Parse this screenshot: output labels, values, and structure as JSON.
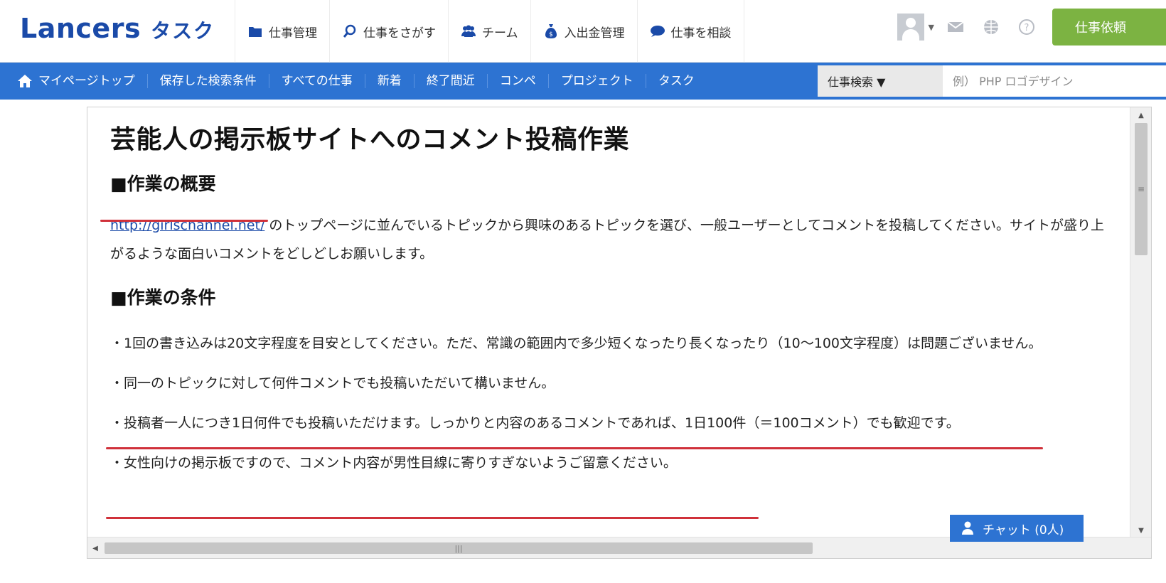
{
  "brand": {
    "logo_main": "Lancers",
    "logo_sub": "タスク",
    "color": "#1a4aa8"
  },
  "header": {
    "nav": [
      {
        "label": "仕事管理",
        "icon": "folder-icon"
      },
      {
        "label": "仕事をさがす",
        "icon": "search-icon"
      },
      {
        "label": "チーム",
        "icon": "team-icon"
      },
      {
        "label": "入出金管理",
        "icon": "money-bag-icon"
      },
      {
        "label": "仕事を相談",
        "icon": "chat-bubble-icon"
      }
    ],
    "order_button": "仕事依頼"
  },
  "subnav": {
    "items": [
      "マイページトップ",
      "保存した検索条件",
      "すべての仕事",
      "新着",
      "終了間近",
      "コンペ",
      "プロジェクト",
      "タスク"
    ],
    "search_select": "仕事検索 ▼",
    "search_placeholder": "例） PHP ロゴデザイン"
  },
  "article": {
    "title": "芸能人の掲示板サイトへのコメント投稿作業",
    "section1_heading": "■作業の概要",
    "p1_link": "http://girlschannel.net/",
    "p1_rest": " のトップページに並んでいるトピックから興味のあるトピックを選び、一般ユーザーとしてコメントを投稿してください。サイトが盛り上がるような面白いコメントをどしどしお願いします。",
    "section2_heading": "■作業の条件",
    "p2": "・1回の書き込みは20文字程度を目安としてください。ただ、常識の範囲内で多少短くなったり長くなったり（10〜100文字程度）は問題ございません。",
    "p3": "・同一のトピックに対して何件コメントでも投稿いただいて構いません。",
    "p4": "・投稿者一人につき1日何件でも投稿いただけます。しっかりと内容のあるコメントであれば、1日100件（＝100コメント）でも歓迎です。",
    "p5": "・女性向けの掲示板ですので、コメント内容が男性目線に寄りすぎないようご留意ください。"
  },
  "chat": {
    "label": "チャット (0人)"
  },
  "colors": {
    "accent": "#2d73d2",
    "order": "#7cb342",
    "highlight": "#d0313a"
  }
}
